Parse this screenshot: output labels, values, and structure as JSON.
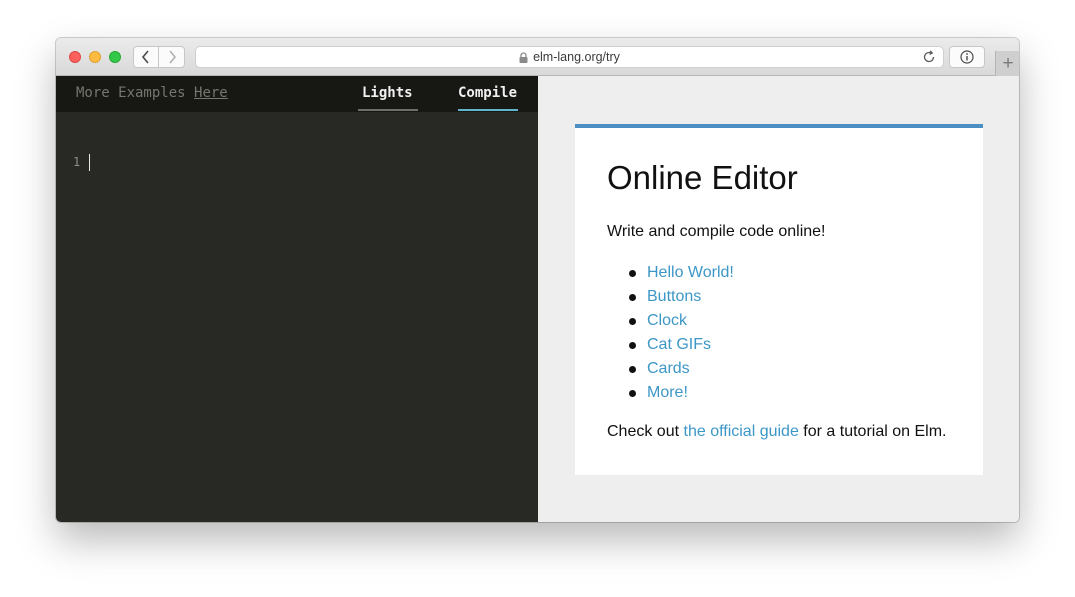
{
  "browser": {
    "url": "elm-lang.org/try",
    "new_tab_label": "+"
  },
  "editor": {
    "more_examples_label": "More Examples",
    "here_link": "Here",
    "lights_button": "Lights",
    "compile_button": "Compile",
    "line_numbers": [
      "1"
    ]
  },
  "preview": {
    "title": "Online Editor",
    "intro": "Write and compile code online!",
    "examples": [
      "Hello World!",
      "Buttons",
      "Clock",
      "Cat GIFs",
      "Cards",
      "More!"
    ],
    "outro_prefix": "Check out",
    "outro_link": "the official guide",
    "outro_suffix": "for a tutorial on Elm."
  },
  "colors": {
    "editor_background": "#282825",
    "editor_header": "#171713",
    "compile_underline": "#60b5cc",
    "card_top_border": "#4a8ec2",
    "link": "#3c97c7"
  },
  "icons": [
    "back-arrow-icon",
    "forward-arrow-icon",
    "lock-icon",
    "reload-icon",
    "info-icon",
    "new-tab-icon"
  ]
}
